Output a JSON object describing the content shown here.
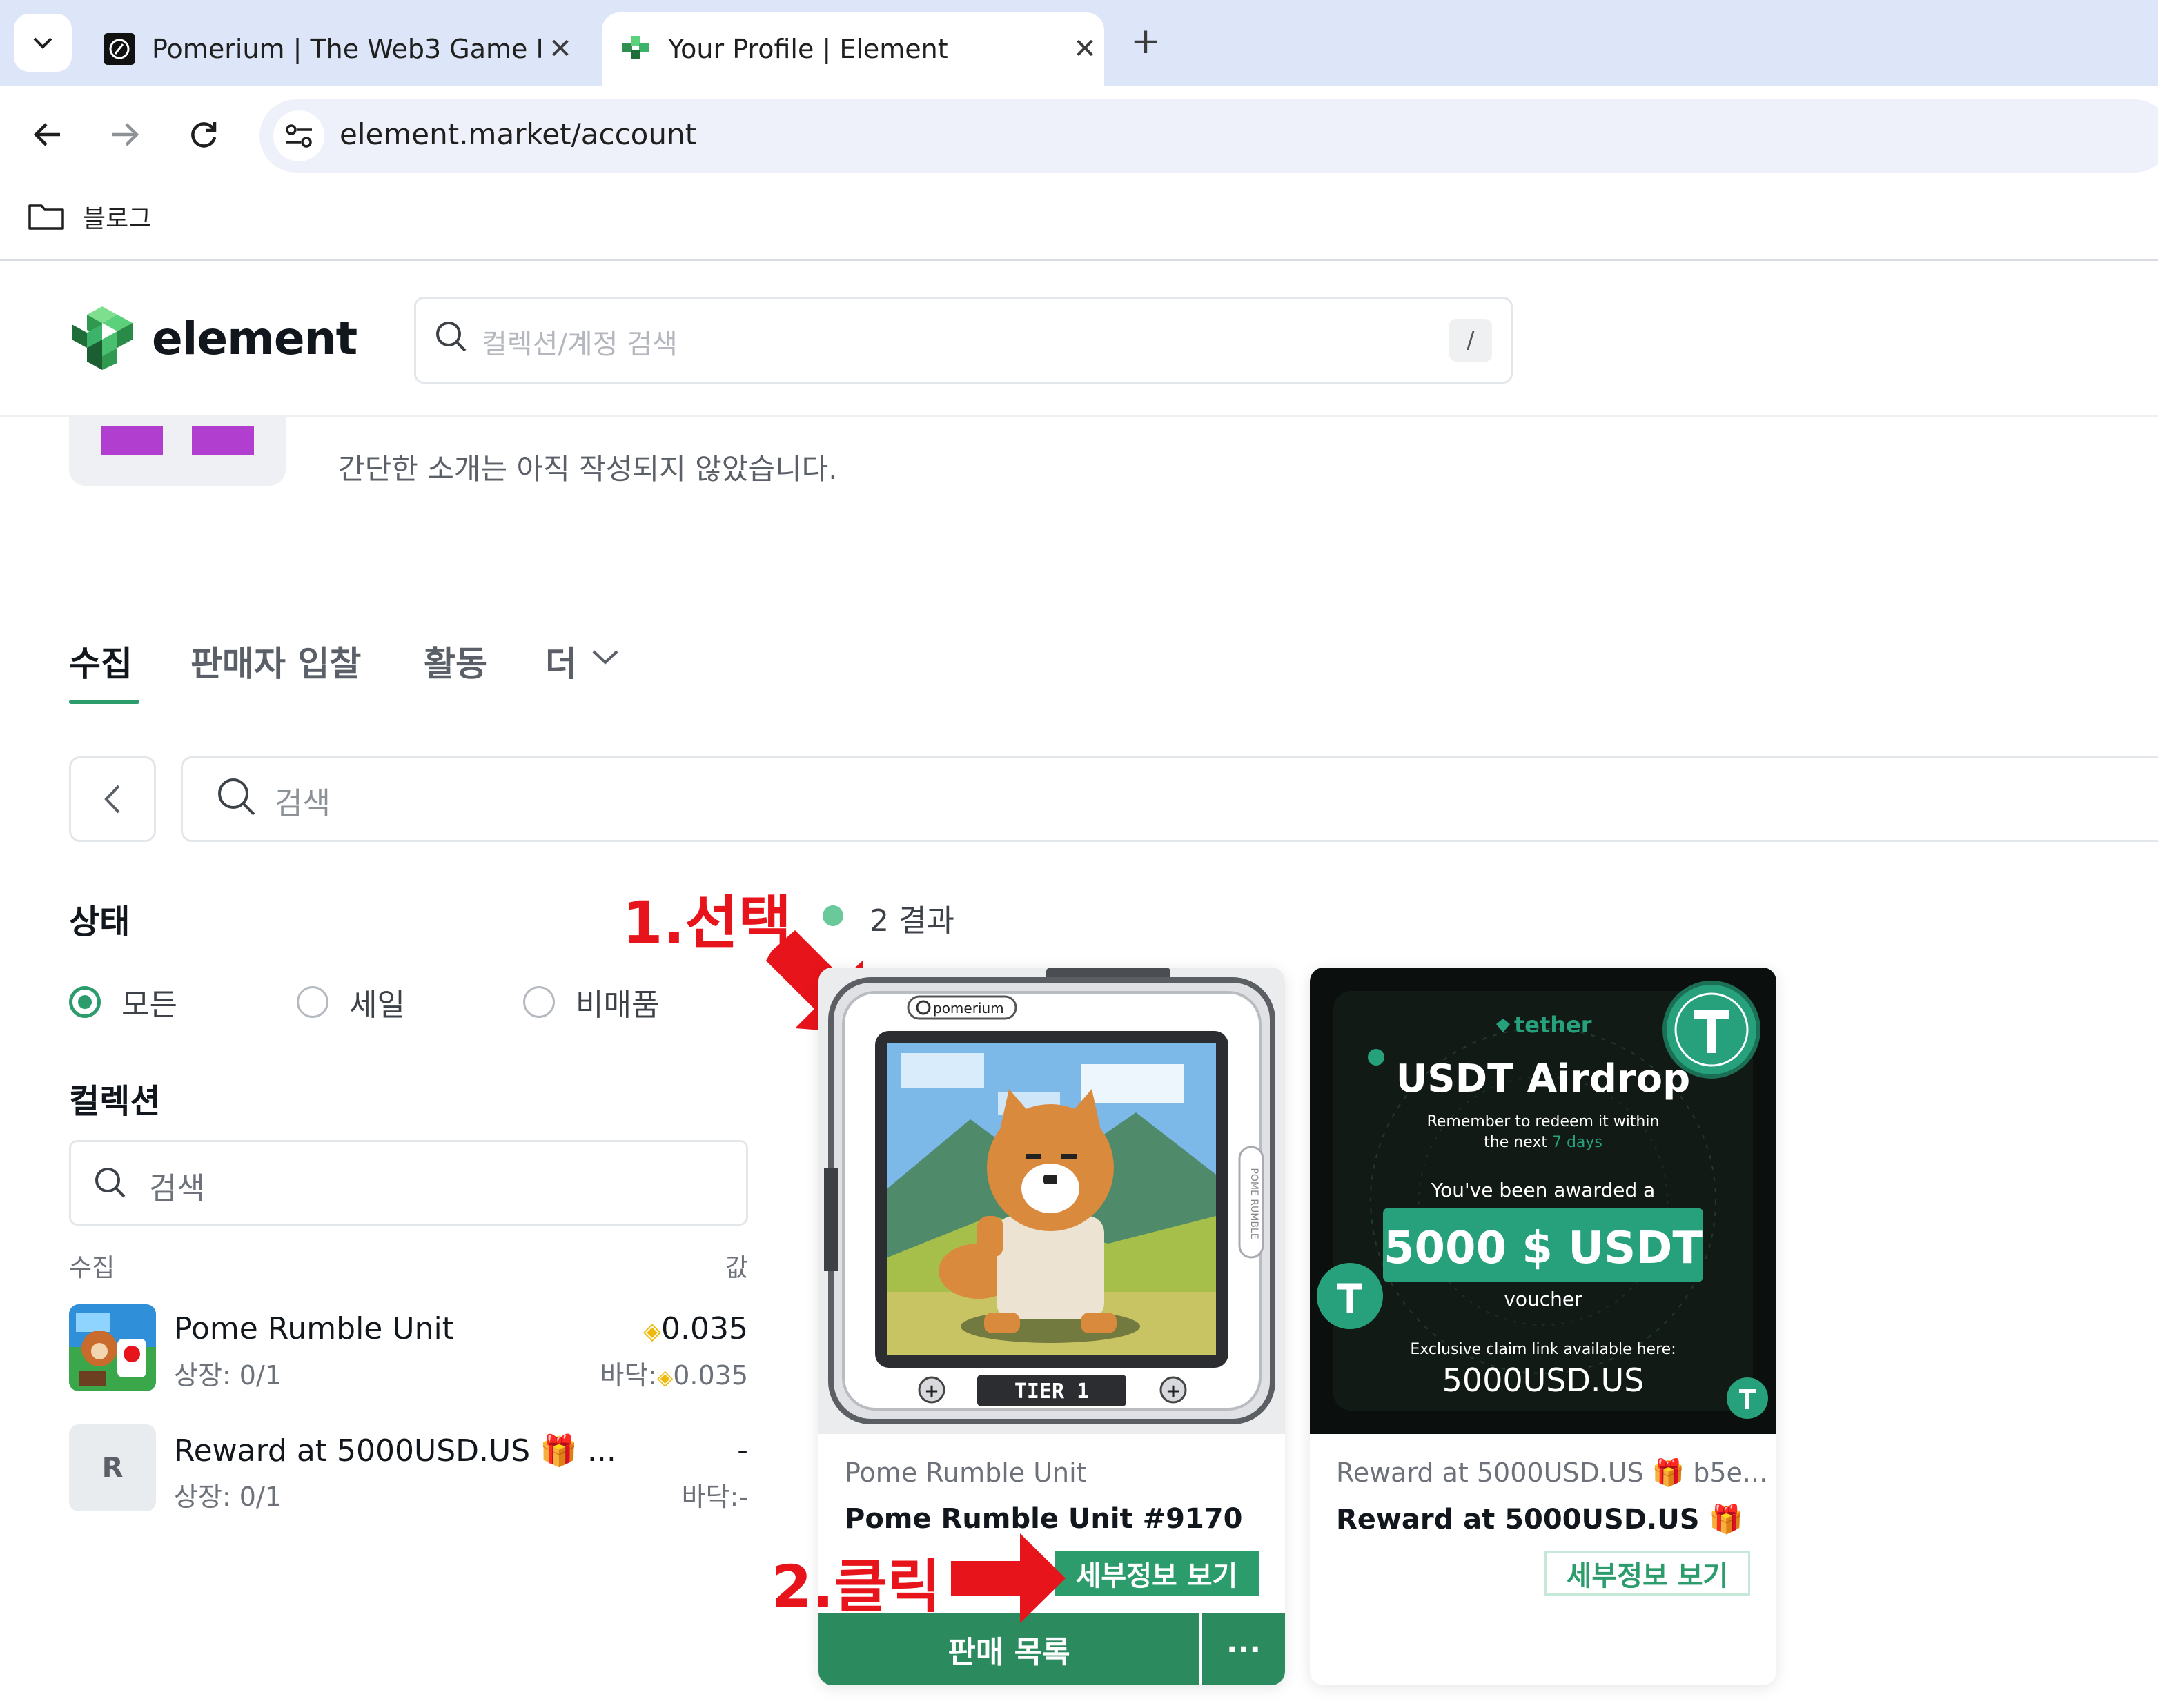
{
  "browser": {
    "tabs": [
      {
        "title": "Pomerium | The Web3 Game F",
        "active": false
      },
      {
        "title": "Your Profile | Element",
        "active": true
      }
    ],
    "url": "element.market/account",
    "bookmark_folder": "블로그"
  },
  "site": {
    "brand": "element",
    "search_placeholder": "컬렉션/계정 검색",
    "search_shortcut": "/"
  },
  "profile": {
    "bio": "간단한 소개는 아직 작성되지 않았습니다."
  },
  "profile_tabs": [
    {
      "label": "수집",
      "active": true
    },
    {
      "label": "판매자 입찰",
      "active": false
    },
    {
      "label": "활동",
      "active": false
    },
    {
      "label": "더",
      "active": false
    }
  ],
  "filter": {
    "search_placeholder": "검색"
  },
  "sidebar": {
    "status_heading": "상태",
    "status_options": [
      {
        "label": "모든",
        "selected": true
      },
      {
        "label": "세일",
        "selected": false
      },
      {
        "label": "비매품",
        "selected": false
      }
    ],
    "collection_heading": "컬렉션",
    "collection_search_placeholder": "검색",
    "col_left": "수집",
    "col_right": "값",
    "collections": [
      {
        "name": "Pome Rumble Unit",
        "listed": "상장: 0/1",
        "value": "0.035",
        "floor": "바닥:",
        "floor_value": "0.035"
      },
      {
        "name": "Reward at 5000USD.US 🎁 ...",
        "initial": "R",
        "listed": "상장: 0/1",
        "value": "-",
        "floor": "바닥:-"
      }
    ]
  },
  "results": {
    "count_label": "2 결과",
    "cards": [
      {
        "collection": "Pome Rumble Unit",
        "name": "Pome Rumble Unit #9170",
        "detail_label": "세부정보 보기",
        "list_label": "판매 목록",
        "more_label": "···",
        "image": {
          "brand": "pomerium",
          "tier": "TIER 1",
          "side_text": "POME RUMBLE"
        }
      },
      {
        "collection": "Reward at 5000USD.US 🎁 b5e...",
        "name": "Reward at 5000USD.US 🎁",
        "detail_label": "세부정보 보기",
        "image": {
          "brand": "tether",
          "headline": "USDT Airdrop",
          "line1": "Remember to redeem it within",
          "line2_prefix": "the next ",
          "line2_highlight": "7 days",
          "awarded": "You've been awarded a",
          "amount": "5000 $ USDT",
          "voucher": "voucher",
          "claim": "Exclusive claim link available here:",
          "site": "5000USD.US"
        }
      }
    ]
  },
  "annotations": {
    "step1": "1.선택",
    "step2": "2.클릭"
  },
  "colors": {
    "accent": "#2d9c6c",
    "annotation": "#e8141b",
    "tether_green": "#26a17b"
  }
}
